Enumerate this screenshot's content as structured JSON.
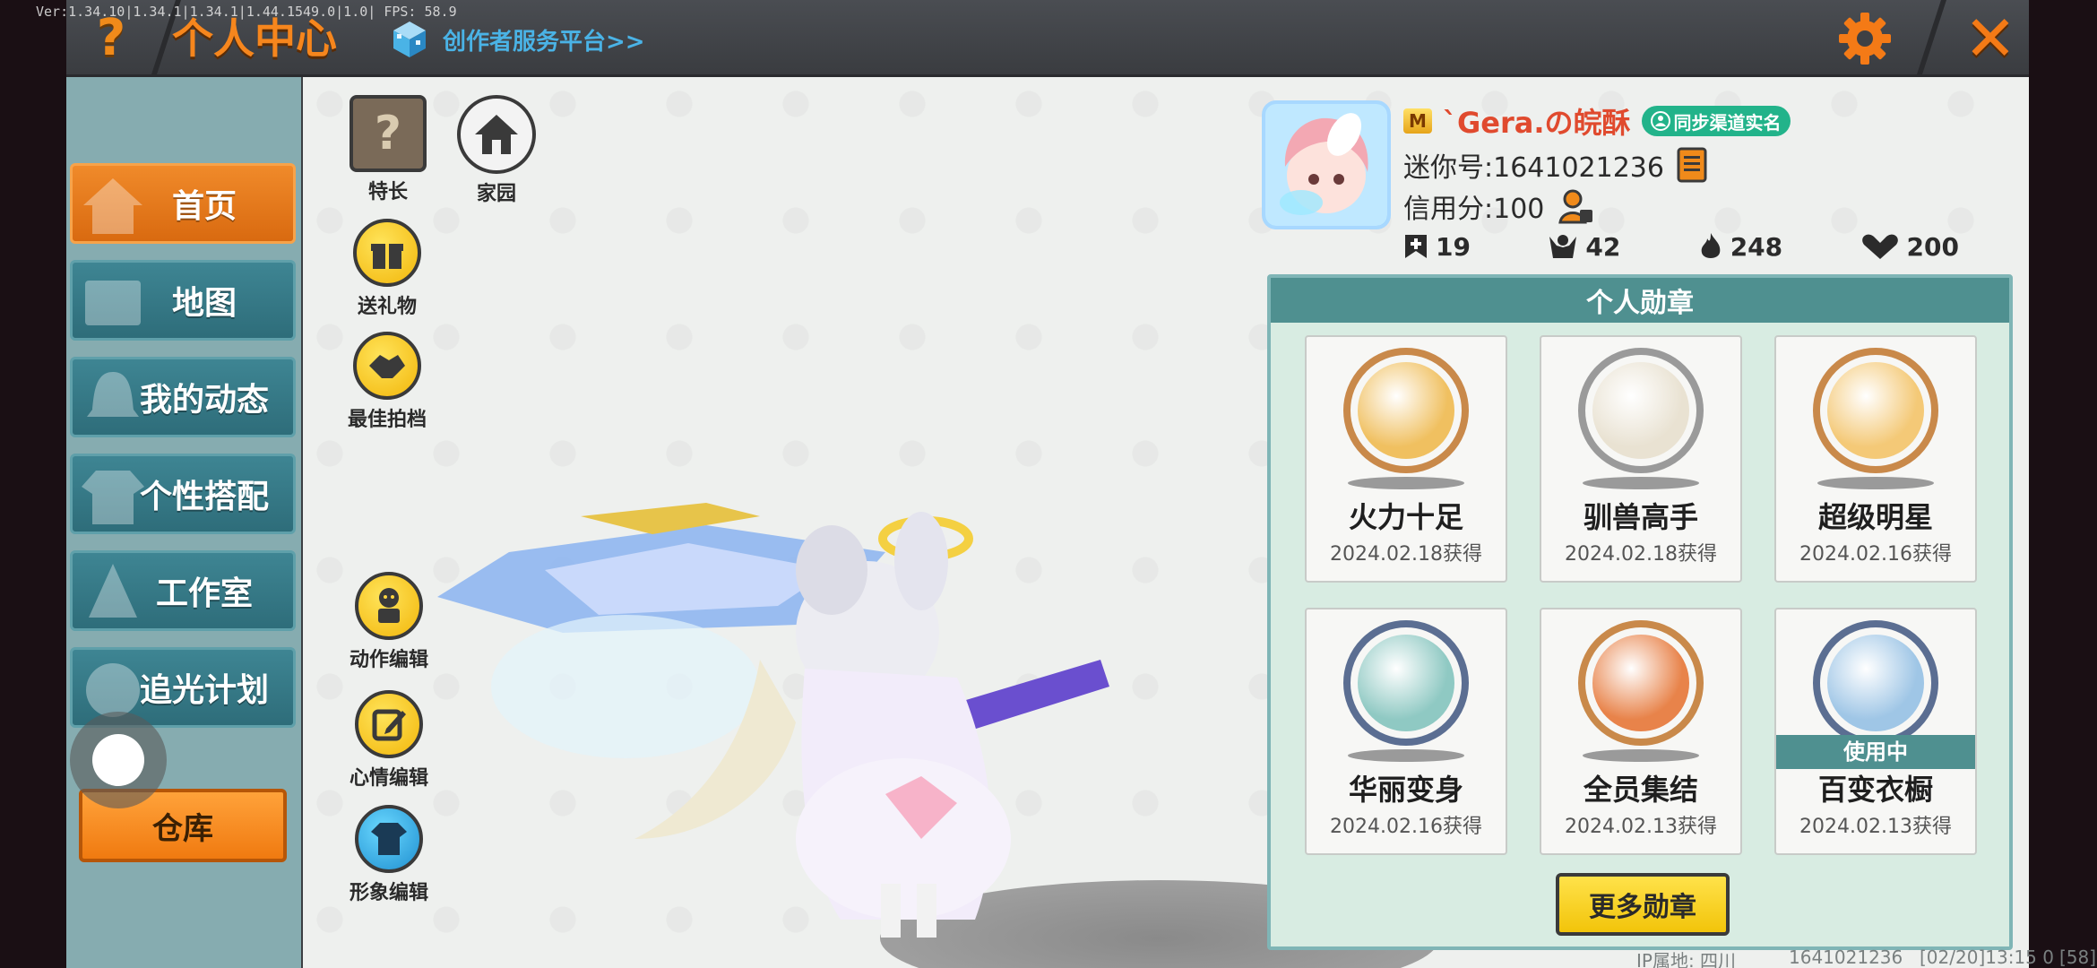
{
  "debug": "Ver:1.34.10|1.34.1|1.34.1|1.44.1549.0|1.0| FPS: 58.9",
  "header": {
    "help_symbol": "?",
    "title": "个人中心",
    "creator_link": "创作者服务平台>>",
    "close_symbol": "✕"
  },
  "sidebar": {
    "items": [
      {
        "label": "首页",
        "active": true
      },
      {
        "label": "地图",
        "active": false
      },
      {
        "label": "我的动态",
        "active": false
      },
      {
        "label": "个性搭配",
        "active": false
      },
      {
        "label": "工作室",
        "active": false
      },
      {
        "label": "追光计划",
        "active": false
      }
    ],
    "storage_label": "仓库"
  },
  "tools": {
    "specialty": "特长",
    "home": "家园",
    "gift": "送礼物",
    "best_shot": "最佳拍档",
    "action_edit": "动作编辑",
    "mood_edit": "心情编辑",
    "look_edit": "形象编辑"
  },
  "profile": {
    "vip_icon": "M",
    "username": "`Gera.の皖酥",
    "realname_badge": "同步渠道实名",
    "mini_id": "迷你号:1641021236",
    "credit": "信用分:100",
    "stats": {
      "posts": "19",
      "fans": "42",
      "popularity": "248",
      "likes": "200"
    }
  },
  "medals": {
    "header": "个人勋章",
    "items": [
      {
        "name": "火力十足",
        "date": "2024.02.18获得",
        "icon": "treasure-chest-icon",
        "ring": "#c9894a",
        "bg": "#f0c060"
      },
      {
        "name": "驯兽高手",
        "date": "2024.02.18获得",
        "icon": "tamer-icon",
        "ring": "#9a9a9a",
        "bg": "#e9e2d2"
      },
      {
        "name": "超级明星",
        "date": "2024.02.16获得",
        "icon": "star-bear-icon",
        "ring": "#c9894a",
        "bg": "#f4c977"
      },
      {
        "name": "华丽变身",
        "date": "2024.02.16获得",
        "icon": "transform-icon",
        "ring": "#5b6e92",
        "bg": "#8fc9c3"
      },
      {
        "name": "全员集结",
        "date": "2024.02.13获得",
        "icon": "gather-icon",
        "ring": "#c9894a",
        "bg": "#e8834a"
      },
      {
        "name": "百变衣橱",
        "date": "2024.02.13获得",
        "icon": "wardrobe-icon",
        "ring": "#5b6e92",
        "bg": "#9fc6e6"
      }
    ],
    "in_use_label": "使用中",
    "more_label": "更多勋章"
  },
  "footer": {
    "ip_location": "IP属地: 四川",
    "uid": "1641021236",
    "timestamp": "[02/20]13:15 0",
    "fps_tag": "[58]"
  },
  "colors": {
    "accent_orange": "#f6861d",
    "teal": "#4f9090",
    "nav_blue": "#3e8593",
    "panel_green": "#d8ece2"
  }
}
